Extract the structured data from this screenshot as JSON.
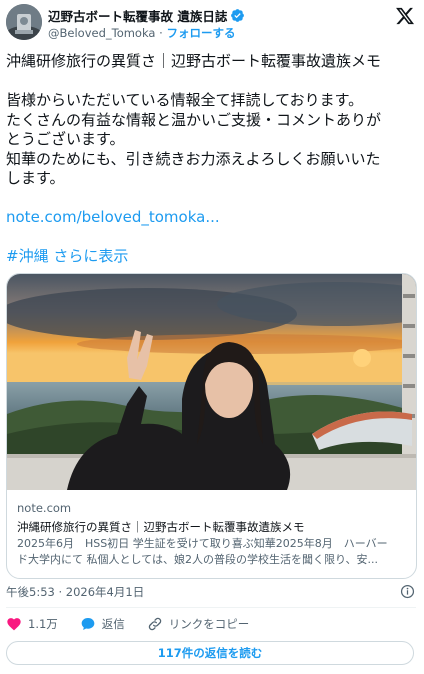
{
  "author": {
    "display_name": "辺野古ボート転覆事故 遺族日誌",
    "handle": "@Beloved_Tomoka",
    "separator": "·",
    "follow_label": "フォローする",
    "avatar_icon": "avatar-monument-photo",
    "verified_icon": "verified-badge-icon",
    "verified_color": "#1d9bf0"
  },
  "platform_icon": "x-logo-icon",
  "tweet": {
    "lines": [
      "沖縄研修旅行の異質さ｜辺野古ボート転覆事故遺族メモ",
      "",
      "皆様からいただいている情報全て拝読しております。",
      "たくさんの有益な情報と温かいご支援・コメントありが",
      "とうございます。",
      "知華のためにも、引き続きお力添えよろしくお願いいた",
      "します。",
      ""
    ],
    "link_text": "note.com/beloved_tomoka...",
    "hashtag": "#沖縄",
    "show_more": "さらに表示"
  },
  "card": {
    "domain": "note.com",
    "title": "沖縄研修旅行の異質さ｜辺野古ボート転覆事故遺族メモ",
    "description_lines": [
      "2025年6月　HSS初日 学生証を受けて取り喜ぶ知華2025年8月　ハーバー",
      "ド大学内にて 私個人としては、娘2人の普段の学校生活を聞く限り、安..."
    ]
  },
  "timestamp": "午後5:53 · 2026年4月1日",
  "actions": {
    "like_count": "1.1万",
    "reply_label": "返信",
    "copy_link_label": "リンクをコピー",
    "like_color": "#f91880",
    "reply_color": "#1d9bf0"
  },
  "read_replies_label": "117件の返信を読む",
  "colors": {
    "accent": "#1d9bf0",
    "text": "#0f1419",
    "secondary_text": "#536471",
    "border": "#cfd9de"
  }
}
